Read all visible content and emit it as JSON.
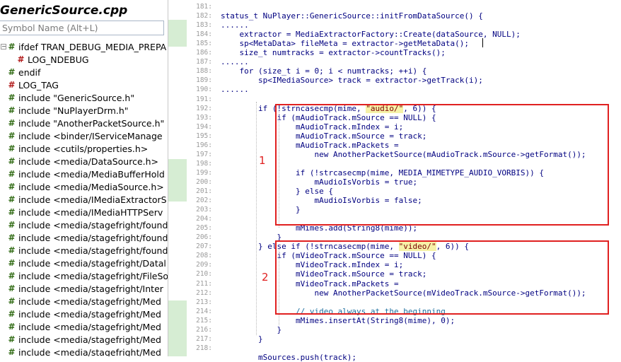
{
  "sidebar": {
    "file_title": "GenericSource.cpp",
    "search_placeholder": "Symbol Name (Alt+L)",
    "items": [
      {
        "label": "ifdef TRAN_DEBUG_MEDIA_PREPA",
        "icon": "hash-icon",
        "color": "green",
        "expander": true
      },
      {
        "label": "LOG_NDEBUG",
        "icon": "hash-icon",
        "color": "red",
        "child": true
      },
      {
        "label": "endif",
        "icon": "hash-icon",
        "color": "green"
      },
      {
        "label": "LOG_TAG",
        "icon": "hash-icon",
        "color": "red"
      },
      {
        "label": "include \"GenericSource.h\"",
        "icon": "hash-icon",
        "color": "green"
      },
      {
        "label": "include \"NuPlayerDrm.h\"",
        "icon": "hash-icon",
        "color": "green"
      },
      {
        "label": "include \"AnotherPacketSource.h\"",
        "icon": "hash-icon",
        "color": "green"
      },
      {
        "label": "include <binder/IServiceManage",
        "icon": "hash-icon",
        "color": "green"
      },
      {
        "label": "include <cutils/properties.h>",
        "icon": "hash-icon",
        "color": "green"
      },
      {
        "label": "include <media/DataSource.h>",
        "icon": "hash-icon",
        "color": "green"
      },
      {
        "label": "include <media/MediaBufferHold",
        "icon": "hash-icon",
        "color": "green"
      },
      {
        "label": "include <media/MediaSource.h>",
        "icon": "hash-icon",
        "color": "green"
      },
      {
        "label": "include <media/IMediaExtractorS",
        "icon": "hash-icon",
        "color": "green"
      },
      {
        "label": "include <media/IMediaHTTPServ",
        "icon": "hash-icon",
        "color": "green"
      },
      {
        "label": "include <media/stagefright/found",
        "icon": "hash-icon",
        "color": "green"
      },
      {
        "label": "include <media/stagefright/found",
        "icon": "hash-icon",
        "color": "green"
      },
      {
        "label": "include <media/stagefright/found",
        "icon": "hash-icon",
        "color": "green"
      },
      {
        "label": "include <media/stagefright/Datal",
        "icon": "hash-icon",
        "color": "green"
      },
      {
        "label": "include <media/stagefright/FileSo",
        "icon": "hash-icon",
        "color": "green"
      },
      {
        "label": "include <media/stagefright/Inter",
        "icon": "hash-icon",
        "color": "green"
      },
      {
        "label": "include <media/stagefright/Med",
        "icon": "hash-icon",
        "color": "green"
      },
      {
        "label": "include <media/stagefright/Med",
        "icon": "hash-icon",
        "color": "green"
      },
      {
        "label": "include <media/stagefright/Med",
        "icon": "hash-icon",
        "color": "green"
      },
      {
        "label": "include <media/stagefright/Med",
        "icon": "hash-icon",
        "color": "green"
      },
      {
        "label": "include <media/stagefright/Med",
        "icon": "hash-icon",
        "color": "green"
      }
    ]
  },
  "editor": {
    "line_numbers": [
      "181:",
      "182:",
      "183:",
      "184:",
      "185:",
      "186:",
      "187:",
      "188:",
      "189:",
      "190:",
      "191:",
      "192:",
      "193:",
      "194:",
      "195:",
      "196:",
      "197:",
      "198:",
      "199:",
      "200:",
      "201:",
      "202:",
      "203:",
      "204:",
      "205:",
      "206:",
      "207:",
      "208:",
      "209:",
      "210:",
      "211:",
      "212:",
      "213:",
      "214:",
      "215:",
      "216:",
      "217:",
      "218:"
    ],
    "code_lines": [
      [],
      [
        {
          "t": "status_t NuPlayer::GenericSource::initFromDataSource() {",
          "c": "a"
        }
      ],
      [
        {
          "t": "......",
          "c": "a"
        }
      ],
      [
        {
          "t": "    extractor = MediaExtractorFactory::Create(dataSource, NULL);",
          "c": "a"
        }
      ],
      [
        {
          "t": "    sp<MetaData> fileMeta = extractor->getMetaData();",
          "c": "a"
        }
      ],
      [
        {
          "t": "    size_t numtracks = extractor->countTracks();",
          "c": "a"
        }
      ],
      [
        {
          "t": "......",
          "c": "a"
        }
      ],
      [
        {
          "t": "    for (size_t i = 0; i < numtracks; ++i) {",
          "c": "a"
        }
      ],
      [
        {
          "t": "        sp<IMediaSource> track = extractor->getTrack(i);",
          "c": "a"
        }
      ],
      [
        {
          "t": "......",
          "c": "a"
        }
      ],
      [],
      [
        {
          "t": "        if (!strncasecmp(mime, ",
          "c": "a"
        },
        {
          "t": "\"audio/\"",
          "c": "s",
          "hl": true
        },
        {
          "t": ", 6)) {",
          "c": "a"
        }
      ],
      [
        {
          "t": "            if (mAudioTrack.mSource == NULL) {",
          "c": "a"
        }
      ],
      [
        {
          "t": "                mAudioTrack.mIndex = i;",
          "c": "a"
        }
      ],
      [
        {
          "t": "                mAudioTrack.mSource = track;",
          "c": "a"
        }
      ],
      [
        {
          "t": "                mAudioTrack.mPackets =",
          "c": "a"
        }
      ],
      [
        {
          "t": "                    new AnotherPacketSource(mAudioTrack.mSource->getFormat());",
          "c": "a"
        }
      ],
      [],
      [
        {
          "t": "                if (!strcasecmp(mime, MEDIA_MIMETYPE_AUDIO_VORBIS)) {",
          "c": "a"
        }
      ],
      [
        {
          "t": "                    mAudioIsVorbis = true;",
          "c": "a"
        }
      ],
      [
        {
          "t": "                } else {",
          "c": "a"
        }
      ],
      [
        {
          "t": "                    mAudioIsVorbis = false;",
          "c": "a"
        }
      ],
      [
        {
          "t": "                }",
          "c": "a"
        }
      ],
      [],
      [
        {
          "t": "                mMimes.add(String8(mime));",
          "c": "a"
        }
      ],
      [
        {
          "t": "            }",
          "c": "a"
        }
      ],
      [
        {
          "t": "        } else if (!strncasecmp(mime, ",
          "c": "a"
        },
        {
          "t": "\"video/\"",
          "c": "s",
          "hl": true
        },
        {
          "t": ", 6)) {",
          "c": "a"
        }
      ],
      [
        {
          "t": "            if (mVideoTrack.mSource == NULL) {",
          "c": "a"
        }
      ],
      [
        {
          "t": "                mVideoTrack.mIndex = i;",
          "c": "a"
        }
      ],
      [
        {
          "t": "                mVideoTrack.mSource = track;",
          "c": "a"
        }
      ],
      [
        {
          "t": "                mVideoTrack.mPackets =",
          "c": "a"
        }
      ],
      [
        {
          "t": "                    new AnotherPacketSource(mVideoTrack.mSource->getFormat());",
          "c": "a"
        }
      ],
      [],
      [
        {
          "t": "                // video always at the beginning",
          "c": "t"
        }
      ],
      [
        {
          "t": "                mMimes.insertAt(String8(mime), 0);",
          "c": "a"
        }
      ],
      [
        {
          "t": "            }",
          "c": "a"
        }
      ],
      [
        {
          "t": "        }",
          "c": "a"
        }
      ],
      [],
      [
        {
          "t": "        mSources.push(track);",
          "c": "a"
        }
      ]
    ]
  },
  "annotations": {
    "box1_label": "1",
    "box2_label": "2",
    "box_color": "#e02020"
  }
}
